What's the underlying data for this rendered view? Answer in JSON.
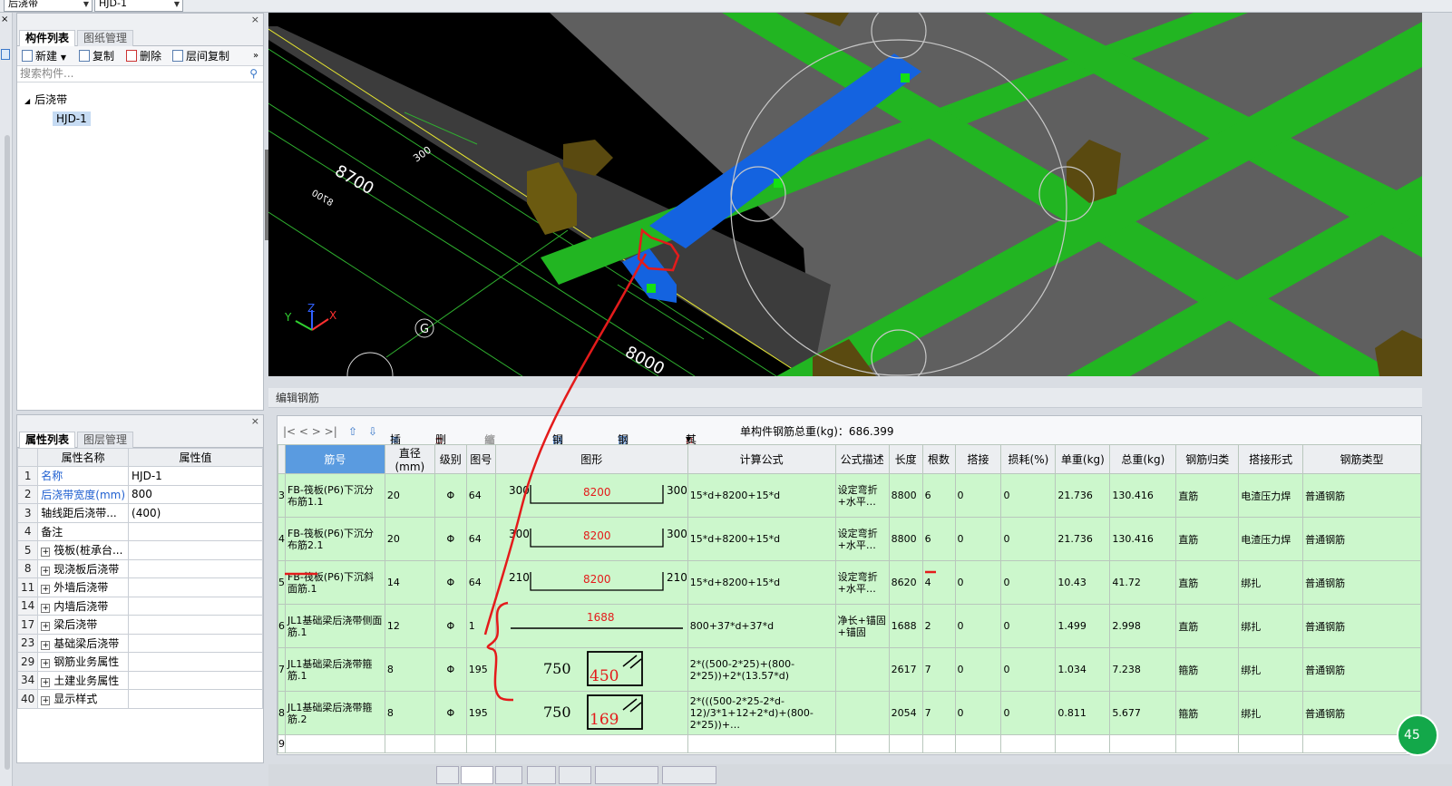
{
  "topbar": {
    "select1": "后浇带",
    "select2": "HJD-1"
  },
  "component_panel": {
    "tabs": [
      "构件列表",
      "图纸管理"
    ],
    "toolbar": {
      "new": "新建",
      "copy": "复制",
      "delete": "删除",
      "floor_copy": "层间复制"
    },
    "search_placeholder": "搜索构件...",
    "tree": {
      "root": "后浇带",
      "child": "HJD-1"
    }
  },
  "property_panel": {
    "tabs": [
      "属性列表",
      "图层管理"
    ],
    "headers": {
      "name": "属性名称",
      "value": "属性值"
    },
    "rows": [
      {
        "num": "1",
        "name": "名称",
        "value": "HJD-1",
        "blue": true,
        "plus": false
      },
      {
        "num": "2",
        "name": "后浇带宽度(mm)",
        "value": "800",
        "blue": true,
        "plus": false
      },
      {
        "num": "3",
        "name": "轴线距后浇带...",
        "value": "(400)",
        "blue": false,
        "plus": false
      },
      {
        "num": "4",
        "name": "备注",
        "value": "",
        "blue": false,
        "plus": false
      },
      {
        "num": "5",
        "name": "筏板(桩承台...",
        "value": "",
        "blue": false,
        "plus": true
      },
      {
        "num": "8",
        "name": "现浇板后浇带",
        "value": "",
        "blue": false,
        "plus": true
      },
      {
        "num": "11",
        "name": "外墙后浇带",
        "value": "",
        "blue": false,
        "plus": true
      },
      {
        "num": "14",
        "name": "内墙后浇带",
        "value": "",
        "blue": false,
        "plus": true
      },
      {
        "num": "17",
        "name": "梁后浇带",
        "value": "",
        "blue": false,
        "plus": true
      },
      {
        "num": "23",
        "name": "基础梁后浇带",
        "value": "",
        "blue": false,
        "plus": true
      },
      {
        "num": "29",
        "name": "钢筋业务属性",
        "value": "",
        "blue": false,
        "plus": true
      },
      {
        "num": "34",
        "name": "土建业务属性",
        "value": "",
        "blue": false,
        "plus": true
      },
      {
        "num": "40",
        "name": "显示样式",
        "value": "",
        "blue": false,
        "plus": true
      }
    ]
  },
  "viewport": {
    "dims": {
      "d1": "8700",
      "d2": "300",
      "d3": "8700",
      "d4": "8000"
    },
    "axis": {
      "x": "X",
      "y": "Y",
      "z": "Z"
    },
    "grid_label": "G"
  },
  "edit_panel": {
    "title": "编辑钢筋",
    "toolbar": {
      "nav": "|< < > >|",
      "insert": "插入",
      "delete": "删除",
      "scale": "缩尺配筋",
      "info": "钢筋信息",
      "lib": "钢筋图库",
      "other": "其他",
      "total": "单构件钢筋总重(kg)：686.399"
    },
    "columns": [
      "筋号",
      "直径(mm)",
      "级别",
      "图号",
      "图形",
      "计算公式",
      "公式描述",
      "长度",
      "根数",
      "搭接",
      "损耗(%)",
      "单重(kg)",
      "总重(kg)",
      "钢筋归类",
      "搭接形式",
      "钢筋类型"
    ],
    "rows": [
      {
        "rn": "3",
        "name": "FB-筏板(P6)下沉分布筋1.1",
        "dia": "20",
        "grade": "Φ",
        "fig": "64",
        "shape": "u",
        "left": "300",
        "mid": "8200",
        "right": "300",
        "formula": "15*d+8200+15*d",
        "desc": "设定弯折+水平…",
        "len": "8800",
        "count": "6",
        "lap": "0",
        "loss": "0",
        "unit": "21.736",
        "total": "130.416",
        "cls": "直筋",
        "lapform": "电渣压力焊",
        "type": "普通钢筋"
      },
      {
        "rn": "4",
        "name": "FB-筏板(P6)下沉分布筋2.1",
        "dia": "20",
        "grade": "Φ",
        "fig": "64",
        "shape": "u",
        "left": "300",
        "mid": "8200",
        "right": "300",
        "formula": "15*d+8200+15*d",
        "desc": "设定弯折+水平…",
        "len": "8800",
        "count": "6",
        "lap": "0",
        "loss": "0",
        "unit": "21.736",
        "total": "130.416",
        "cls": "直筋",
        "lapform": "电渣压力焊",
        "type": "普通钢筋"
      },
      {
        "rn": "5",
        "name": "FB-筏板(P6)下沉斜面筋.1",
        "dia": "14",
        "grade": "Φ",
        "fig": "64",
        "shape": "u",
        "left": "210",
        "mid": "8200",
        "right": "210",
        "formula": "15*d+8200+15*d",
        "desc": "设定弯折+水平…",
        "len": "8620",
        "count": "4",
        "lap": "0",
        "loss": "0",
        "unit": "10.43",
        "total": "41.72",
        "cls": "直筋",
        "lapform": "绑扎",
        "type": "普通钢筋"
      },
      {
        "rn": "6",
        "name": "JL1基础梁后浇带侧面筋.1",
        "dia": "12",
        "grade": "Φ",
        "fig": "1",
        "shape": "line",
        "left": "",
        "mid": "1688",
        "right": "",
        "formula": "800+37*d+37*d",
        "desc": "净长+锚固+锚固",
        "len": "1688",
        "count": "2",
        "lap": "0",
        "loss": "0",
        "unit": "1.499",
        "total": "2.998",
        "cls": "直筋",
        "lapform": "绑扎",
        "type": "普通钢筋"
      },
      {
        "rn": "7",
        "name": "JL1基础梁后浇带箍筋.1",
        "dia": "8",
        "grade": "Φ",
        "fig": "195",
        "shape": "stirrup",
        "left": "750",
        "mid": "450",
        "right": "",
        "formula": "2*((500-2*25)+(800-2*25))+2*(13.57*d)",
        "desc": "",
        "len": "2617",
        "count": "7",
        "lap": "0",
        "loss": "0",
        "unit": "1.034",
        "total": "7.238",
        "cls": "箍筋",
        "lapform": "绑扎",
        "type": "普通钢筋"
      },
      {
        "rn": "8",
        "name": "JL1基础梁后浇带箍筋.2",
        "dia": "8",
        "grade": "Φ",
        "fig": "195",
        "shape": "stirrup",
        "left": "750",
        "mid": "169",
        "right": "",
        "formula": "2*(((500-2*25-2*d-12)/3*1+12+2*d)+(800-2*25))+…",
        "desc": "",
        "len": "2054",
        "count": "7",
        "lap": "0",
        "loss": "0",
        "unit": "0.811",
        "total": "5.677",
        "cls": "箍筋",
        "lapform": "绑扎",
        "type": "普通钢筋"
      }
    ],
    "empty_row": "9"
  },
  "badge": "45",
  "colors": {
    "green": "#22b522",
    "blue": "#1463e0",
    "row_green": "#ccf7cc",
    "annotation_red": "#e41b1b"
  }
}
